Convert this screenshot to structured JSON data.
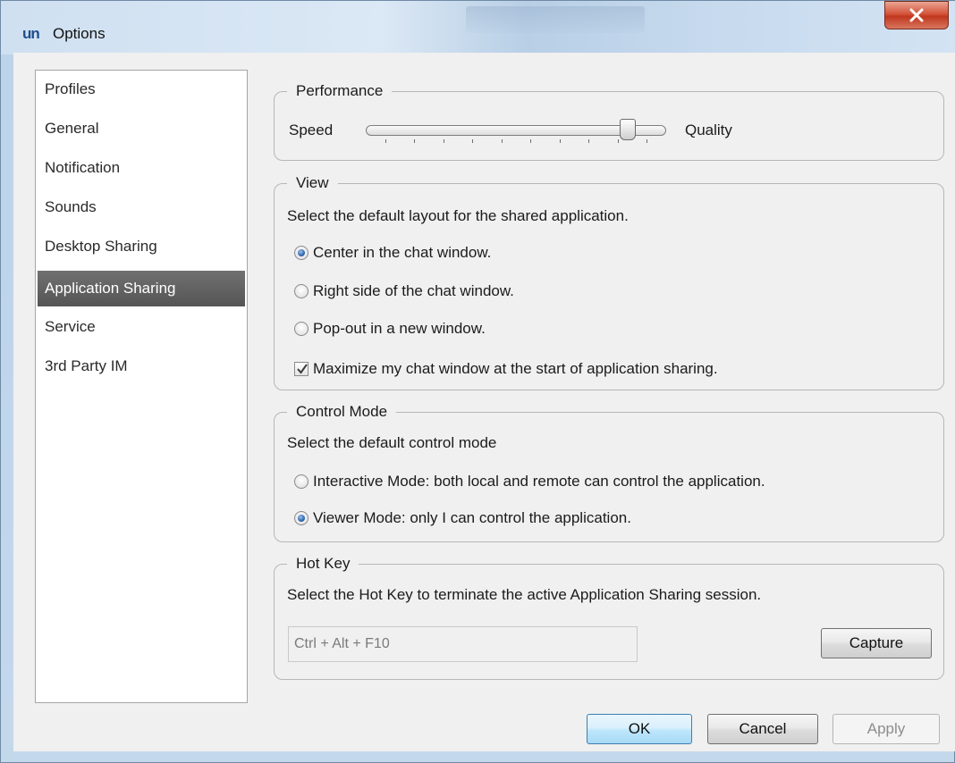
{
  "window": {
    "logo_text": "un",
    "title": "Options"
  },
  "sidebar": {
    "items": [
      {
        "label": "Profiles"
      },
      {
        "label": "General"
      },
      {
        "label": "Notification"
      },
      {
        "label": "Sounds"
      },
      {
        "label": "Desktop Sharing"
      },
      {
        "label": "Application  Sharing",
        "selected": true
      },
      {
        "label": "Service"
      },
      {
        "label": "3rd Party IM"
      }
    ]
  },
  "performance": {
    "legend": "Performance",
    "left_label": "Speed",
    "right_label": "Quality",
    "slider_level": 0.88,
    "tick_count": 10
  },
  "view": {
    "legend": "View",
    "description": "Select the default layout for the shared application.",
    "options": [
      {
        "label": "Center in the chat window.",
        "checked": true
      },
      {
        "label": "Right side of the chat window.",
        "checked": false
      },
      {
        "label": "Pop-out in a new window.",
        "checked": false
      }
    ],
    "maximize_label": "Maximize my chat window at the start of application sharing.",
    "maximize_checked": true
  },
  "control_mode": {
    "legend": "Control Mode",
    "description": "Select the default control mode",
    "options": [
      {
        "label": "Interactive Mode: both local and remote can control the application.",
        "checked": false
      },
      {
        "label": "Viewer Mode: only I can control the application.",
        "checked": true
      }
    ]
  },
  "hot_key": {
    "legend": "Hot Key",
    "description": "Select the Hot Key to terminate the active Application Sharing session.",
    "value": "Ctrl + Alt + F10",
    "capture_label": "Capture"
  },
  "footer": {
    "ok_label": "OK",
    "cancel_label": "Cancel",
    "apply_label": "Apply"
  },
  "colors": {
    "selected_nav_bg": "#5f5f5f",
    "close_button": "#c94a30",
    "default_button_border": "#3c7fb1"
  }
}
